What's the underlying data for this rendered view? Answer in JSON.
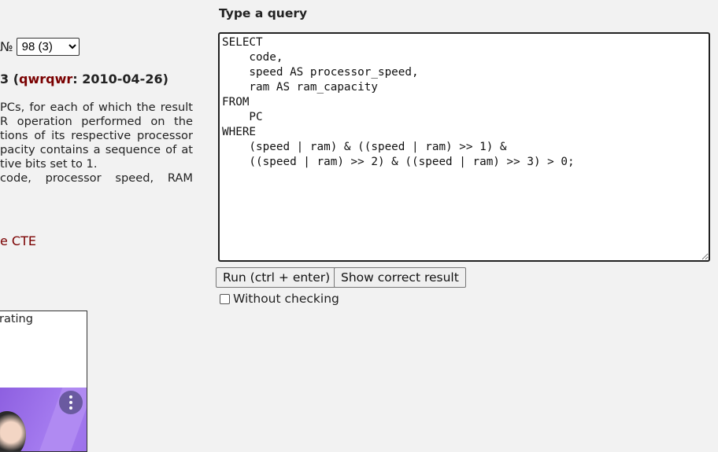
{
  "task_selector": {
    "prefix": "№",
    "selected": "98 (3)"
  },
  "author": {
    "prefix": "3 (",
    "name": "qwrqwr",
    "suffix": ": 2010-04-26)"
  },
  "task_lines": [
    "PCs, for each of which the result",
    "R operation performed on the",
    "tions of its respective processor",
    "pacity contains a sequence of at",
    "tive bits set to 1.",
    " code, processor speed, RAM"
  ],
  "cte_link": "e CTE",
  "ad": {
    "rating_text": "rating"
  },
  "query": {
    "title": "Type a query",
    "code": "SELECT\n    code,\n    speed AS processor_speed,\n    ram AS ram_capacity\nFROM\n    PC\nWHERE\n    (speed | ram) & ((speed | ram) >> 1) &\n    ((speed | ram) >> 2) & ((speed | ram) >> 3) > 0;"
  },
  "buttons": {
    "run": "Run (ctrl + enter)",
    "show_correct": "Show correct result"
  },
  "without_checking": {
    "label": "Without checking",
    "checked": false
  }
}
